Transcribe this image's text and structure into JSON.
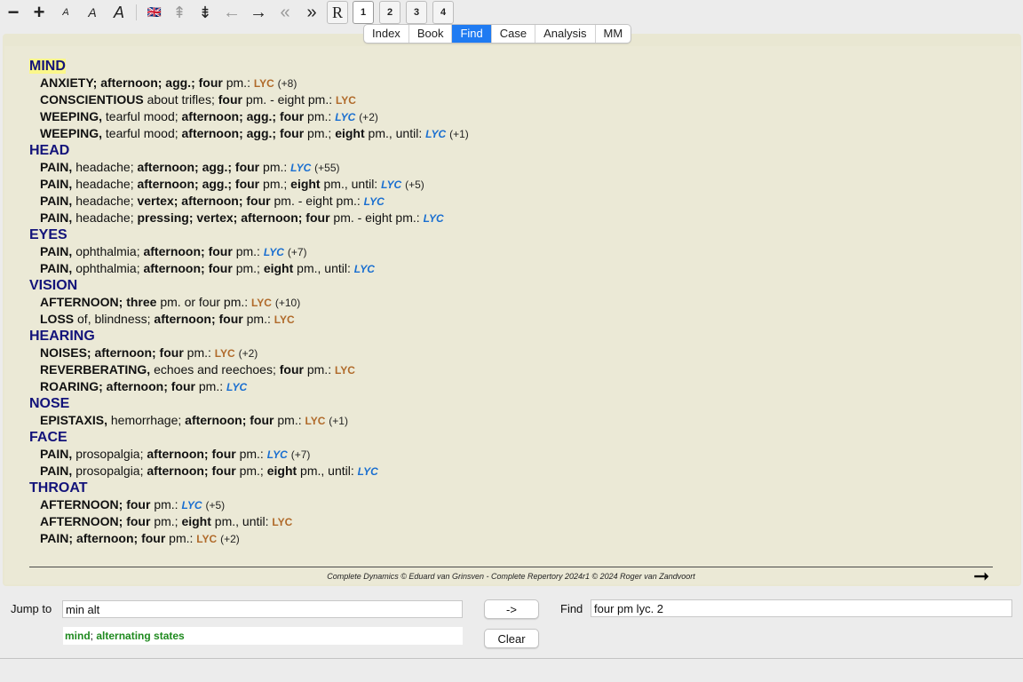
{
  "toolbar": {
    "zoom_out": "−",
    "zoom_in": "+",
    "font_a1": "A",
    "font_a2": "A",
    "font_a3": "A",
    "language_flag": "🇬🇧",
    "up": "⇞",
    "down": "⇟",
    "back": "←",
    "forward": "→",
    "first": "«",
    "last": "»",
    "repertory": "R",
    "views": [
      "1",
      "2",
      "3",
      "4"
    ]
  },
  "tabs": [
    "Index",
    "Book",
    "Find",
    "Case",
    "Analysis",
    "MM"
  ],
  "selected_tab": "Find",
  "results": [
    {
      "chapter": "MIND",
      "highlight": true,
      "rubrics": [
        {
          "parts": [
            [
              "b",
              "ANXIETY; afternoon; agg.; four"
            ],
            [
              "t",
              " pm.: "
            ]
          ],
          "remedy": "LYC",
          "remedy_style": "brown",
          "count": "(+8)"
        },
        {
          "parts": [
            [
              "b",
              "CONSCIENTIOUS"
            ],
            [
              "t",
              " about trifles; "
            ],
            [
              "b",
              "four"
            ],
            [
              "t",
              " pm. - eight pm.: "
            ]
          ],
          "remedy": "LYC",
          "remedy_style": "brown",
          "count": ""
        },
        {
          "parts": [
            [
              "b",
              "WEEPING,"
            ],
            [
              "t",
              " tearful mood; "
            ],
            [
              "b",
              "afternoon; agg.; four"
            ],
            [
              "t",
              " pm.: "
            ]
          ],
          "remedy": "LYC",
          "remedy_style": "blue",
          "count": "(+2)"
        },
        {
          "parts": [
            [
              "b",
              "WEEPING,"
            ],
            [
              "t",
              " tearful mood; "
            ],
            [
              "b",
              "afternoon; agg.; four"
            ],
            [
              "t",
              " pm.; "
            ],
            [
              "b",
              "eight"
            ],
            [
              "t",
              " pm., until: "
            ]
          ],
          "remedy": "LYC",
          "remedy_style": "blue",
          "count": "(+1)"
        }
      ]
    },
    {
      "chapter": "HEAD",
      "highlight": false,
      "rubrics": [
        {
          "parts": [
            [
              "b",
              "PAIN,"
            ],
            [
              "t",
              " headache; "
            ],
            [
              "b",
              "afternoon; agg.; four"
            ],
            [
              "t",
              " pm.: "
            ]
          ],
          "remedy": "LYC",
          "remedy_style": "blue",
          "count": "(+55)"
        },
        {
          "parts": [
            [
              "b",
              "PAIN,"
            ],
            [
              "t",
              " headache; "
            ],
            [
              "b",
              "afternoon; agg.; four"
            ],
            [
              "t",
              " pm.; "
            ],
            [
              "b",
              "eight"
            ],
            [
              "t",
              " pm., until: "
            ]
          ],
          "remedy": "LYC",
          "remedy_style": "blue",
          "count": "(+5)"
        },
        {
          "parts": [
            [
              "b",
              "PAIN,"
            ],
            [
              "t",
              " headache; "
            ],
            [
              "b",
              "vertex; afternoon; four"
            ],
            [
              "t",
              " pm. - eight pm.: "
            ]
          ],
          "remedy": "LYC",
          "remedy_style": "blue",
          "count": ""
        },
        {
          "parts": [
            [
              "b",
              "PAIN,"
            ],
            [
              "t",
              " headache; "
            ],
            [
              "b",
              "pressing; vertex; afternoon; four"
            ],
            [
              "t",
              " pm. - eight pm.: "
            ]
          ],
          "remedy": "LYC",
          "remedy_style": "blue",
          "count": ""
        }
      ]
    },
    {
      "chapter": "EYES",
      "highlight": false,
      "rubrics": [
        {
          "parts": [
            [
              "b",
              "PAIN,"
            ],
            [
              "t",
              " ophthalmia; "
            ],
            [
              "b",
              "afternoon; four"
            ],
            [
              "t",
              " pm.: "
            ]
          ],
          "remedy": "LYC",
          "remedy_style": "blue",
          "count": "(+7)"
        },
        {
          "parts": [
            [
              "b",
              "PAIN,"
            ],
            [
              "t",
              " ophthalmia; "
            ],
            [
              "b",
              "afternoon; four"
            ],
            [
              "t",
              " pm.; "
            ],
            [
              "b",
              "eight"
            ],
            [
              "t",
              " pm., until: "
            ]
          ],
          "remedy": "LYC",
          "remedy_style": "blue",
          "count": ""
        }
      ]
    },
    {
      "chapter": "VISION",
      "highlight": false,
      "rubrics": [
        {
          "parts": [
            [
              "b",
              "AFTERNOON; three"
            ],
            [
              "t",
              " pm. or four pm.: "
            ]
          ],
          "remedy": "LYC",
          "remedy_style": "brown",
          "count": "(+10)"
        },
        {
          "parts": [
            [
              "b",
              "LOSS"
            ],
            [
              "t",
              " of, blindness; "
            ],
            [
              "b",
              "afternoon; four"
            ],
            [
              "t",
              " pm.: "
            ]
          ],
          "remedy": "LYC",
          "remedy_style": "brown",
          "count": ""
        }
      ]
    },
    {
      "chapter": "HEARING",
      "highlight": false,
      "rubrics": [
        {
          "parts": [
            [
              "b",
              "NOISES; afternoon; four"
            ],
            [
              "t",
              " pm.: "
            ]
          ],
          "remedy": "LYC",
          "remedy_style": "brown",
          "count": "(+2)"
        },
        {
          "parts": [
            [
              "b",
              "REVERBERATING,"
            ],
            [
              "t",
              " echoes and reechoes; "
            ],
            [
              "b",
              "four"
            ],
            [
              "t",
              " pm.: "
            ]
          ],
          "remedy": "LYC",
          "remedy_style": "brown",
          "count": ""
        },
        {
          "parts": [
            [
              "b",
              "ROARING; afternoon; four"
            ],
            [
              "t",
              " pm.: "
            ]
          ],
          "remedy": "LYC",
          "remedy_style": "blue",
          "count": ""
        }
      ]
    },
    {
      "chapter": "NOSE",
      "highlight": false,
      "rubrics": [
        {
          "parts": [
            [
              "b",
              "EPISTAXIS,"
            ],
            [
              "t",
              " hemorrhage; "
            ],
            [
              "b",
              "afternoon; four"
            ],
            [
              "t",
              " pm.: "
            ]
          ],
          "remedy": "LYC",
          "remedy_style": "brown",
          "count": "(+1)"
        }
      ]
    },
    {
      "chapter": "FACE",
      "highlight": false,
      "rubrics": [
        {
          "parts": [
            [
              "b",
              "PAIN,"
            ],
            [
              "t",
              " prosopalgia; "
            ],
            [
              "b",
              "afternoon; four"
            ],
            [
              "t",
              " pm.: "
            ]
          ],
          "remedy": "LYC",
          "remedy_style": "blue",
          "count": "(+7)"
        },
        {
          "parts": [
            [
              "b",
              "PAIN,"
            ],
            [
              "t",
              " prosopalgia; "
            ],
            [
              "b",
              "afternoon; four"
            ],
            [
              "t",
              " pm.; "
            ],
            [
              "b",
              "eight"
            ],
            [
              "t",
              " pm., until: "
            ]
          ],
          "remedy": "LYC",
          "remedy_style": "blue",
          "count": ""
        }
      ]
    },
    {
      "chapter": "THROAT",
      "highlight": false,
      "rubrics": [
        {
          "parts": [
            [
              "b",
              "AFTERNOON; four"
            ],
            [
              "t",
              " pm.: "
            ]
          ],
          "remedy": "LYC",
          "remedy_style": "blue",
          "count": "(+5)"
        },
        {
          "parts": [
            [
              "b",
              "AFTERNOON; four"
            ],
            [
              "t",
              " pm.; "
            ],
            [
              "b",
              "eight"
            ],
            [
              "t",
              " pm., until: "
            ]
          ],
          "remedy": "LYC",
          "remedy_style": "brown",
          "count": ""
        },
        {
          "parts": [
            [
              "b",
              "PAIN; afternoon; four"
            ],
            [
              "t",
              " pm.: "
            ]
          ],
          "remedy": "LYC",
          "remedy_style": "brown",
          "count": "(+2)"
        }
      ]
    }
  ],
  "footer": {
    "copyright": "Complete Dynamics © Eduard van Grinsven   -   Complete Repertory 2024r1 © 2024 Roger van Zandvoort",
    "next_arrow": "➞"
  },
  "bottom": {
    "jump_label": "Jump to",
    "jump_value": "min alt",
    "jump_suggestion_prefix": "mind",
    "jump_suggestion_sep": "; ",
    "jump_suggestion_rest": "alternating states",
    "go_button": "->",
    "clear_button": "Clear",
    "find_label": "Find",
    "find_value": "four pm lyc. 2"
  },
  "colors": {
    "chapter": "#13137a",
    "remedy_brown": "#b06a2a",
    "remedy_blue": "#1a6fd0",
    "selected_tab": "#1f7bf2",
    "content_bg": "#ebe9d6",
    "suggestion": "#1f8a1f"
  }
}
